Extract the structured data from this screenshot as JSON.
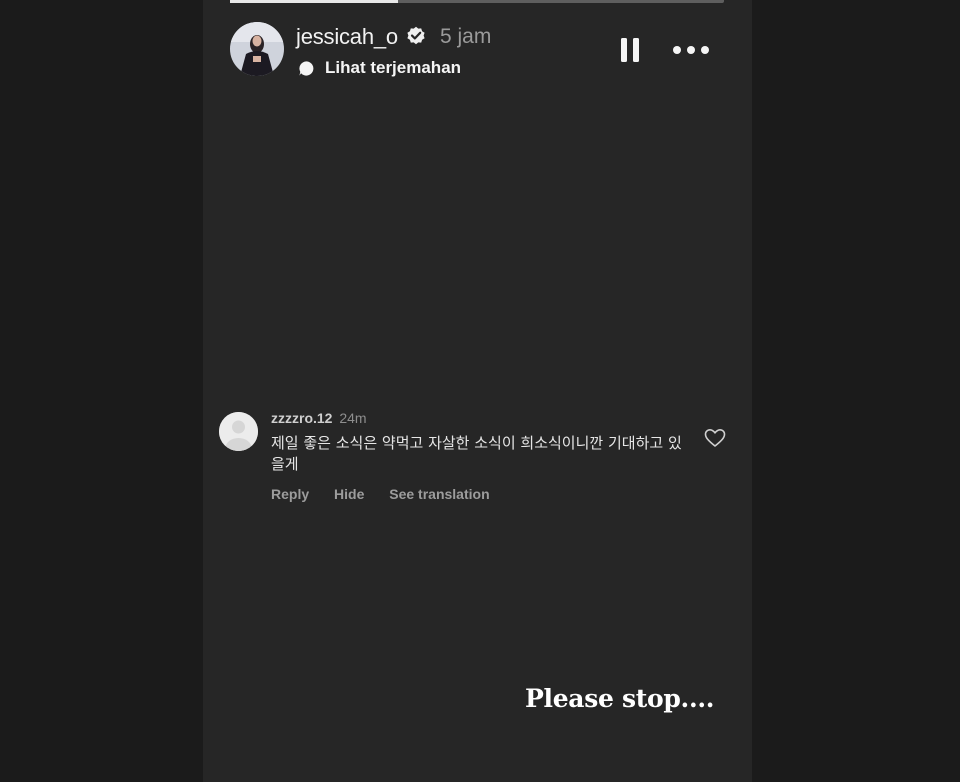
{
  "story": {
    "progress": 0.34,
    "username": "jessicah_o",
    "verified": true,
    "time": "5 jam",
    "translate_label": "Lihat terjemahan",
    "overlay_caption": "Please stop...."
  },
  "icons": {
    "verified": "verified-badge-icon",
    "translate": "chat-bubble-icon",
    "pause": "pause-icon",
    "more": "more-horizontal-icon",
    "like": "heart-outline-icon"
  },
  "comment": {
    "username": "zzzzro.12",
    "time": "24m",
    "text": "제일 좋은 소식은 약먹고 자살한 소식이 희소식이니깐 기대하고 있을게",
    "actions": {
      "reply": "Reply",
      "hide": "Hide",
      "see_translation": "See translation"
    }
  },
  "colors": {
    "page_bg": "#1b1b1b",
    "story_bg": "#262626",
    "text_primary": "#f2f2f2",
    "text_muted": "#9a9a9a"
  }
}
